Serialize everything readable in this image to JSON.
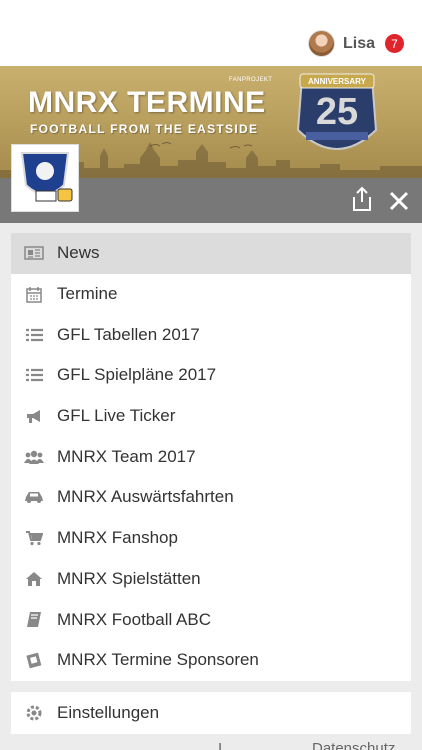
{
  "user": {
    "name": "Lisa",
    "badge": "7"
  },
  "banner": {
    "title": "MNRX TERMINE",
    "subtitle": "FOOTBALL FROM THE EASTSIDE",
    "label": "FANPROJEKT",
    "anniversary_text": "ANNIVERSARY",
    "anniversary_number": "25"
  },
  "menu": {
    "items": [
      {
        "label": "News",
        "icon": "newspaper-icon",
        "active": true
      },
      {
        "label": "Termine",
        "icon": "calendar-icon"
      },
      {
        "label": "GFL Tabellen 2017",
        "icon": "list-icon"
      },
      {
        "label": "GFL Spielpläne 2017",
        "icon": "list-icon"
      },
      {
        "label": "GFL Live Ticker",
        "icon": "megaphone-icon"
      },
      {
        "label": "MNRX Team 2017",
        "icon": "group-icon"
      },
      {
        "label": "MNRX Auswärtsfahrten",
        "icon": "car-icon"
      },
      {
        "label": "MNRX Fanshop",
        "icon": "cart-icon"
      },
      {
        "label": "MNRX Spielstätten",
        "icon": "home-icon"
      },
      {
        "label": "MNRX Football ABC",
        "icon": "book-icon"
      },
      {
        "label": "MNRX Termine Sponsoren",
        "icon": "tickets-icon"
      }
    ]
  },
  "settings": {
    "label": "Einstellungen",
    "icon": "gear-icon"
  },
  "footer": {
    "left_fragment": "I",
    "right_fragment": "Datenschutz"
  },
  "colors": {
    "badge": "#e0242b",
    "banner_gold": "#c9b06e",
    "darkbar": "#787878",
    "active_row": "#dcdcdc"
  }
}
